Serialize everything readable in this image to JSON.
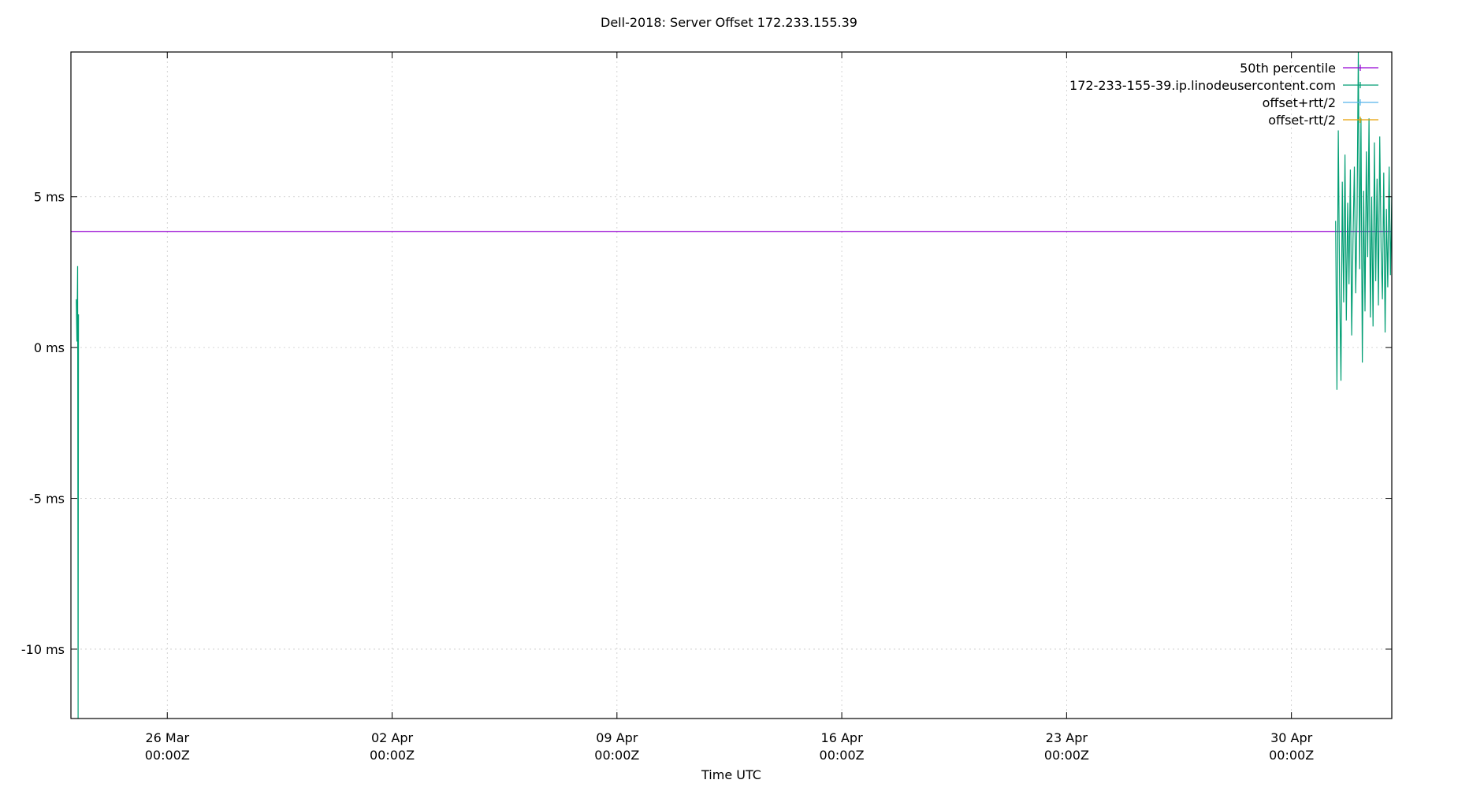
{
  "chart_data": {
    "type": "line",
    "title": "Dell-2018: Server Offset 172.233.155.39",
    "xlabel": "Time UTC",
    "ylabel": "",
    "x_range": [
      "2018-03-23T00:00:00Z",
      "2018-05-03T03:00:00Z"
    ],
    "y_range_ms": [
      -12.3,
      9.8
    ],
    "grid": true,
    "legend_position": "top-right",
    "x_ticks": [
      {
        "time": "2018-03-26T00:00:00Z",
        "line1": "26 Mar",
        "line2": "00:00Z"
      },
      {
        "time": "2018-04-02T00:00:00Z",
        "line1": "02 Apr",
        "line2": "00:00Z"
      },
      {
        "time": "2018-04-09T00:00:00Z",
        "line1": "09 Apr",
        "line2": "00:00Z"
      },
      {
        "time": "2018-04-16T00:00:00Z",
        "line1": "16 Apr",
        "line2": "00:00Z"
      },
      {
        "time": "2018-04-23T00:00:00Z",
        "line1": "23 Apr",
        "line2": "00:00Z"
      },
      {
        "time": "2018-04-30T00:00:00Z",
        "line1": "30 Apr",
        "line2": "00:00Z"
      }
    ],
    "y_ticks": [
      {
        "value": 5,
        "label": "5 ms"
      },
      {
        "value": 0,
        "label": "0 ms"
      },
      {
        "value": -5,
        "label": "-5 ms"
      },
      {
        "value": -10,
        "label": "-10 ms"
      }
    ],
    "series": [
      {
        "name": "50th percentile",
        "color": "#9400d3",
        "kind": "hline",
        "value": 3.85
      },
      {
        "name": "172-233-155-39.ip.linodeusercontent.com",
        "color": "#009e73",
        "kind": "line",
        "segments": [
          [
            {
              "t": "2018-03-23T04:00:00Z",
              "y": 1.6
            },
            {
              "t": "2018-03-23T04:30:00Z",
              "y": 0.2
            },
            {
              "t": "2018-03-23T05:00:00Z",
              "y": 2.7
            },
            {
              "t": "2018-03-23T05:20:00Z",
              "y": -12.3
            },
            {
              "t": "2018-03-23T05:40:00Z",
              "y": 1.1
            }
          ],
          [
            {
              "t": "2018-05-01T09:00:00Z",
              "y": 4.2
            },
            {
              "t": "2018-05-01T10:00:00Z",
              "y": -1.4
            },
            {
              "t": "2018-05-01T11:00:00Z",
              "y": 7.2
            },
            {
              "t": "2018-05-01T12:00:00Z",
              "y": 2.0
            },
            {
              "t": "2018-05-01T13:00:00Z",
              "y": -1.1
            },
            {
              "t": "2018-05-01T14:00:00Z",
              "y": 5.5
            },
            {
              "t": "2018-05-01T15:00:00Z",
              "y": 1.5
            },
            {
              "t": "2018-05-01T16:00:00Z",
              "y": 6.4
            },
            {
              "t": "2018-05-01T17:00:00Z",
              "y": 0.9
            },
            {
              "t": "2018-05-01T18:00:00Z",
              "y": 4.8
            },
            {
              "t": "2018-05-01T19:00:00Z",
              "y": 2.1
            },
            {
              "t": "2018-05-01T20:00:00Z",
              "y": 5.9
            },
            {
              "t": "2018-05-01T21:00:00Z",
              "y": 0.4
            },
            {
              "t": "2018-05-01T22:00:00Z",
              "y": 3.6
            },
            {
              "t": "2018-05-01T23:00:00Z",
              "y": 6.0
            },
            {
              "t": "2018-05-02T00:00:00Z",
              "y": 1.8
            },
            {
              "t": "2018-05-02T01:00:00Z",
              "y": 4.4
            },
            {
              "t": "2018-05-02T02:00:00Z",
              "y": 9.8
            },
            {
              "t": "2018-05-02T03:00:00Z",
              "y": 2.6
            },
            {
              "t": "2018-05-02T04:00:00Z",
              "y": 7.6
            },
            {
              "t": "2018-05-02T05:00:00Z",
              "y": -0.5
            },
            {
              "t": "2018-05-02T06:00:00Z",
              "y": 5.2
            },
            {
              "t": "2018-05-02T07:00:00Z",
              "y": 1.2
            },
            {
              "t": "2018-05-02T08:00:00Z",
              "y": 6.5
            },
            {
              "t": "2018-05-02T09:00:00Z",
              "y": 3.0
            },
            {
              "t": "2018-05-02T10:00:00Z",
              "y": 7.6
            },
            {
              "t": "2018-05-02T11:00:00Z",
              "y": 1.0
            },
            {
              "t": "2018-05-02T12:00:00Z",
              "y": 5.0
            },
            {
              "t": "2018-05-02T13:00:00Z",
              "y": 0.7
            },
            {
              "t": "2018-05-02T14:00:00Z",
              "y": 6.8
            },
            {
              "t": "2018-05-02T15:00:00Z",
              "y": 2.2
            },
            {
              "t": "2018-05-02T16:00:00Z",
              "y": 5.6
            },
            {
              "t": "2018-05-02T17:00:00Z",
              "y": 1.4
            },
            {
              "t": "2018-05-02T18:00:00Z",
              "y": 7.0
            },
            {
              "t": "2018-05-02T19:00:00Z",
              "y": 3.3
            },
            {
              "t": "2018-05-02T20:00:00Z",
              "y": 1.6
            },
            {
              "t": "2018-05-02T21:00:00Z",
              "y": 5.8
            },
            {
              "t": "2018-05-02T22:00:00Z",
              "y": 0.5
            },
            {
              "t": "2018-05-02T23:00:00Z",
              "y": 4.6
            },
            {
              "t": "2018-05-03T00:00:00Z",
              "y": 2.0
            },
            {
              "t": "2018-05-03T01:00:00Z",
              "y": 6.0
            },
            {
              "t": "2018-05-03T02:00:00Z",
              "y": 2.4
            },
            {
              "t": "2018-05-03T03:00:00Z",
              "y": 5.0
            }
          ]
        ]
      },
      {
        "name": "offset+rtt/2",
        "color": "#56b4e9",
        "kind": "line",
        "segments": []
      },
      {
        "name": "offset-rtt/2",
        "color": "#e69f00",
        "kind": "line",
        "segments": []
      }
    ]
  }
}
